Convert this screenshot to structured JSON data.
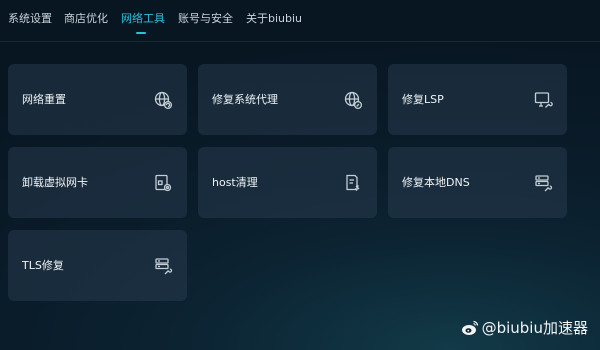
{
  "nav": {
    "tabs": [
      {
        "label": "系统设置"
      },
      {
        "label": "商店优化"
      },
      {
        "label": "网络工具"
      },
      {
        "label": "账号与安全"
      },
      {
        "label": "关于biubiu"
      }
    ],
    "active_tab": "网络工具",
    "accent_color": "#29c2d9"
  },
  "tools": [
    {
      "label": "网络重置",
      "icon": "globe-refresh-icon"
    },
    {
      "label": "修复系统代理",
      "icon": "globe-wrench-icon"
    },
    {
      "label": "修复LSP",
      "icon": "monitor-wrench-icon"
    },
    {
      "label": "卸载虚拟网卡",
      "icon": "card-gear-icon"
    },
    {
      "label": "host清理",
      "icon": "document-broom-icon"
    },
    {
      "label": "修复本地DNS",
      "icon": "server-wrench-icon"
    },
    {
      "label": "TLS修复",
      "icon": "server-wrench-icon"
    }
  ],
  "watermark": {
    "text": "@biubiu加速器"
  }
}
